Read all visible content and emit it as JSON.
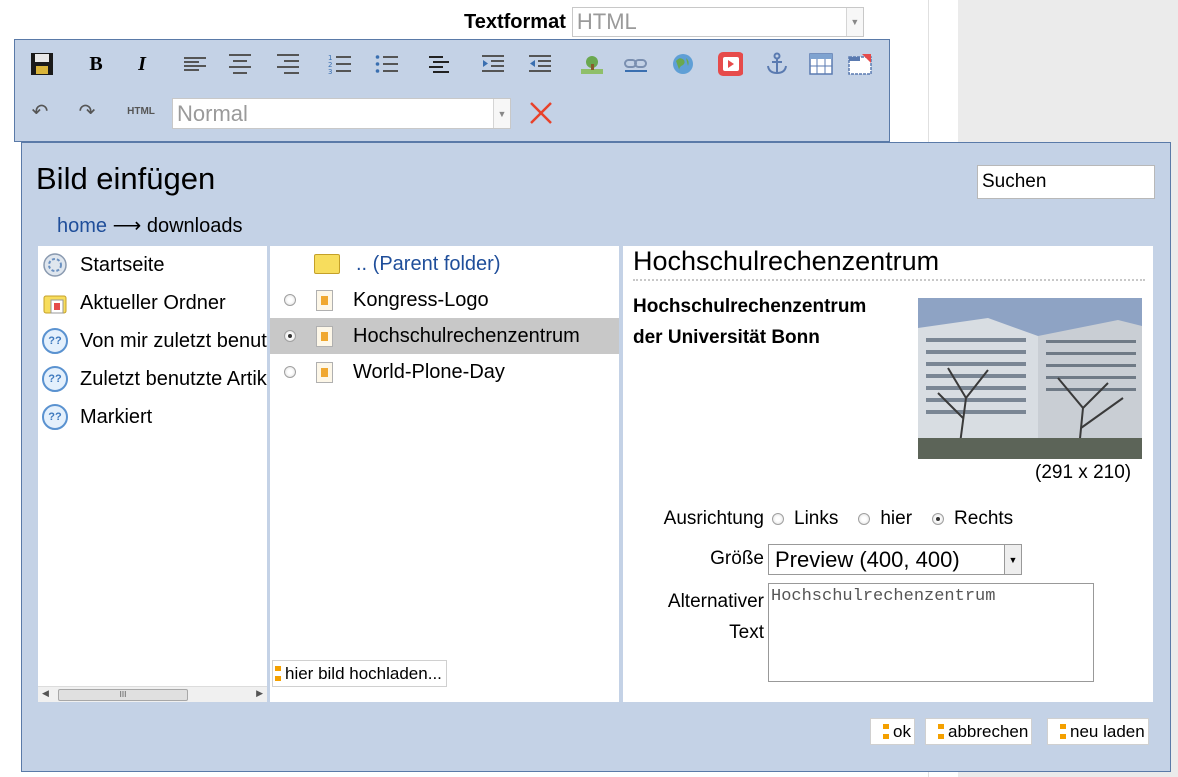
{
  "textformat": {
    "label": "Textformat",
    "value": "HTML"
  },
  "toolbar": {
    "row1": [
      "save-icon",
      "bold-icon",
      "italic-icon",
      "align-left-icon",
      "align-center-icon",
      "align-right-icon",
      "numbered-list-icon",
      "bullet-list-icon",
      "definition-list-icon",
      "indent-icon",
      "outdent-icon",
      "insert-image-icon",
      "insert-link-icon",
      "external-link-icon",
      "insert-video-icon",
      "anchor-icon",
      "insert-table-icon",
      "fullscreen-icon"
    ],
    "row2": {
      "html_label": "HTML",
      "style_value": "Normal"
    },
    "bold": "B",
    "italic": "I"
  },
  "dialog": {
    "title": "Bild einfügen",
    "search_value": "Suchen",
    "breadcrumb": {
      "home": "home",
      "separator": "⟶",
      "current": "downloads"
    }
  },
  "nav": {
    "items": [
      {
        "label": "Startseite",
        "icon": "home-icon"
      },
      {
        "label": "Aktueller Ordner",
        "icon": "current-folder-icon"
      },
      {
        "label": "Von mir zuletzt benutzte Artikel",
        "icon": "recent-icon"
      },
      {
        "label": "Zuletzt benutzte Artikel",
        "icon": "recent-icon"
      },
      {
        "label": "Markiert",
        "icon": "favorite-icon"
      }
    ],
    "scroll_mark": "III"
  },
  "files": {
    "parent": ".. (Parent folder)",
    "items": [
      {
        "label": "Kongress-Logo",
        "selected": false
      },
      {
        "label": "Hochschulrechenzentrum",
        "selected": true
      },
      {
        "label": "World-Plone-Day",
        "selected": false
      }
    ],
    "upload_label": "hier bild hochladen..."
  },
  "preview": {
    "title": "Hochschulrechenzentrum",
    "caption_line1": "Hochschulrechenzentrum",
    "caption_line2": "der Universität Bonn",
    "dimensions": "(291 x 210)",
    "alignment_label": "Ausrichtung",
    "align_options": [
      {
        "label": "Links",
        "selected": false
      },
      {
        "label": "hier",
        "selected": false
      },
      {
        "label": "Rechts",
        "selected": true
      }
    ],
    "size_label": "Größe",
    "size_value": "Preview (400, 400)",
    "alt_label_line1": "Alternativer",
    "alt_label_line2": "Text",
    "alt_value": "Hochschulrechenzentrum"
  },
  "buttons": {
    "ok": "ok",
    "cancel": "abbrechen",
    "reload": "neu laden"
  },
  "colors": {
    "panel": "#c4d2e6",
    "border": "#5a7aa8",
    "link": "#1f4e9a",
    "close_x": "#e8412a",
    "selected_row": "#c8c8c8"
  }
}
